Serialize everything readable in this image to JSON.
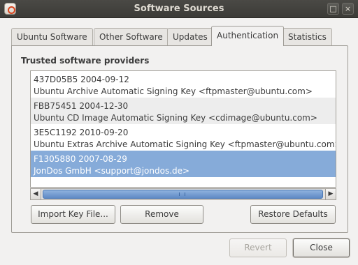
{
  "window": {
    "title": "Software Sources",
    "maximize_glyph": "□",
    "close_glyph": "×"
  },
  "tabs": [
    {
      "label": "Ubuntu Software"
    },
    {
      "label": "Other Software"
    },
    {
      "label": "Updates"
    },
    {
      "label": "Authentication",
      "active": true
    },
    {
      "label": "Statistics"
    }
  ],
  "authentication": {
    "section_title": "Trusted software providers",
    "keys": [
      {
        "id_line": "437D05B5 2004-09-12",
        "name_line": "Ubuntu Archive Automatic Signing Key <ftpmaster@ubuntu.com>"
      },
      {
        "id_line": "FBB75451 2004-12-30",
        "name_line": "Ubuntu CD Image Automatic Signing Key <cdimage@ubuntu.com>"
      },
      {
        "id_line": "3E5C1192 2010-09-20",
        "name_line": "Ubuntu Extras Archive Automatic Signing Key <ftpmaster@ubuntu.com>"
      },
      {
        "id_line": "F1305880 2007-08-29",
        "name_line": "JonDos GmbH <support@jondos.de>",
        "selected": true
      }
    ],
    "scroll_left_glyph": "◀",
    "scroll_right_glyph": "▶",
    "buttons": {
      "import": "Import Key File...",
      "remove": "Remove",
      "restore": "Restore Defaults"
    }
  },
  "dialog_buttons": {
    "revert": "Revert",
    "close": "Close"
  },
  "colors": {
    "selection": "#86abd9",
    "titlebar": "#3c3b37"
  }
}
